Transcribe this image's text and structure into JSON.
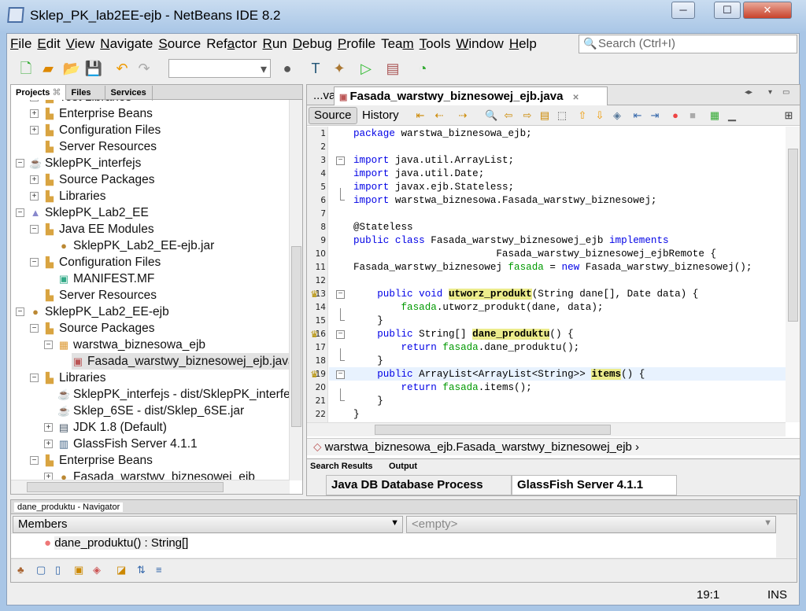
{
  "window": {
    "title": "Sklep_PK_lab2EE-ejb - NetBeans IDE 8.2",
    "minimize": "─",
    "maximize": "☐",
    "close": "✕"
  },
  "menu": [
    {
      "u": "F",
      "rest": "ile"
    },
    {
      "u": "E",
      "rest": "dit"
    },
    {
      "u": "V",
      "rest": "iew"
    },
    {
      "u": "N",
      "rest": "avigate"
    },
    {
      "u": "S",
      "rest": "ource"
    },
    {
      "pre": "Ref",
      "u": "a",
      "rest": "ctor"
    },
    {
      "u": "R",
      "rest": "un"
    },
    {
      "u": "D",
      "rest": "ebug"
    },
    {
      "u": "P",
      "rest": "rofile"
    },
    {
      "pre": "Tea",
      "u": "m",
      "rest": ""
    },
    {
      "u": "T",
      "rest": "ools"
    },
    {
      "u": "W",
      "rest": "indow"
    },
    {
      "u": "H",
      "rest": "elp"
    }
  ],
  "search": {
    "placeholder": "Search (Ctrl+I)"
  },
  "projects": {
    "tabs": [
      "Projects",
      "Files",
      "Services"
    ],
    "close_glyph": "⌘",
    "items": [
      {
        "label": "Test Libraries",
        "level": 1,
        "exp": "+",
        "icon": "library-folder-icon"
      },
      {
        "label": "Enterprise Beans",
        "level": 1,
        "exp": "+",
        "icon": "beans-folder-icon"
      },
      {
        "label": "Configuration Files",
        "level": 1,
        "exp": "+",
        "icon": "config-folder-icon"
      },
      {
        "label": "Server Resources",
        "level": 1,
        "exp": "",
        "icon": "server-folder-icon"
      },
      {
        "label": "SklepPK_interfejs",
        "level": 0,
        "exp": "−",
        "icon": "java-project-icon"
      },
      {
        "label": "Source Packages",
        "level": 1,
        "exp": "+",
        "icon": "source-folder-icon"
      },
      {
        "label": "Libraries",
        "level": 1,
        "exp": "+",
        "icon": "library-folder-icon"
      },
      {
        "label": "SklepPK_Lab2_EE",
        "level": 0,
        "exp": "−",
        "icon": "ee-project-icon"
      },
      {
        "label": "Java EE Modules",
        "level": 1,
        "exp": "−",
        "icon": "modules-folder-icon"
      },
      {
        "label": "SklepPK_Lab2_EE-ejb.jar",
        "level": 2,
        "exp": "",
        "icon": "bean-jar-icon"
      },
      {
        "label": "Configuration Files",
        "level": 1,
        "exp": "−",
        "icon": "config-folder-icon"
      },
      {
        "label": "MANIFEST.MF",
        "level": 2,
        "exp": "",
        "icon": "manifest-file-icon"
      },
      {
        "label": "Server Resources",
        "level": 1,
        "exp": "",
        "icon": "server-folder-icon"
      },
      {
        "label": "SklepPK_Lab2_EE-ejb",
        "level": 0,
        "exp": "−",
        "icon": "ejb-project-icon"
      },
      {
        "label": "Source Packages",
        "level": 1,
        "exp": "−",
        "icon": "source-folder-icon"
      },
      {
        "label": "warstwa_biznesowa_ejb",
        "level": 2,
        "exp": "−",
        "icon": "package-icon"
      },
      {
        "label": "Fasada_warstwy_biznesowej_ejb.java",
        "level": 3,
        "exp": "",
        "icon": "java-file-icon",
        "selected": true
      },
      {
        "label": "Libraries",
        "level": 1,
        "exp": "−",
        "icon": "library-folder-icon"
      },
      {
        "label": "SklepPK_interfejs - dist/SklepPK_interfejs.jar",
        "level": 2,
        "exp": "",
        "icon": "java-project-icon"
      },
      {
        "label": "Sklep_6SE - dist/Sklep_6SE.jar",
        "level": 2,
        "exp": "",
        "icon": "java-project-icon"
      },
      {
        "label": "JDK 1.8 (Default)",
        "level": 2,
        "exp": "+",
        "icon": "jdk-icon"
      },
      {
        "label": "GlassFish Server 4.1.1",
        "level": 2,
        "exp": "+",
        "icon": "server-icon"
      },
      {
        "label": "Enterprise Beans",
        "level": 1,
        "exp": "−",
        "icon": "beans-folder-icon"
      },
      {
        "label": "Fasada_warstwy_biznesowej_ejb",
        "level": 2,
        "exp": "+",
        "icon": "bean-icon"
      }
    ]
  },
  "editor": {
    "prev_tab": "...va",
    "active_tab": "Fasada_warstwy_biznesowej_ejb.java",
    "source_label": "Source",
    "history_label": "History",
    "current_line": 19,
    "lines": [
      [
        {
          "k": "kw",
          "t": "package"
        },
        {
          "t": " warstwa_biznesowa_ejb;"
        }
      ],
      [],
      [
        {
          "k": "kw",
          "t": "import"
        },
        {
          "t": " java.util.ArrayList;"
        }
      ],
      [
        {
          "k": "kw",
          "t": "import"
        },
        {
          "t": " java.util.Date;"
        }
      ],
      [
        {
          "k": "kw",
          "t": "import"
        },
        {
          "t": " javax.ejb.Stateless;"
        }
      ],
      [
        {
          "k": "kw",
          "t": "import"
        },
        {
          "t": " warstwa_biznesowa.Fasada_warstwy_biznesowej;"
        }
      ],
      [],
      [
        {
          "t": "@Stateless"
        }
      ],
      [
        {
          "k": "kw",
          "t": "public class"
        },
        {
          "t": " Fasada_warstwy_biznesowej_ejb "
        },
        {
          "k": "kw",
          "t": "implements"
        }
      ],
      [
        {
          "t": "                        Fasada_warstwy_biznesowej_ejbRemote {"
        }
      ],
      [
        {
          "t": "Fasada_warstwy_biznesowej "
        },
        {
          "k": "fld",
          "t": "fasada"
        },
        {
          "t": " = "
        },
        {
          "k": "kw",
          "t": "new"
        },
        {
          "t": " Fasada_warstwy_biznesowej();"
        }
      ],
      [],
      [
        {
          "t": "    "
        },
        {
          "k": "kw",
          "t": "public void"
        },
        {
          "t": " "
        },
        {
          "k": "hl",
          "t": "utworz_produkt"
        },
        {
          "t": "(String dane[], Date data) {"
        }
      ],
      [
        {
          "t": "        "
        },
        {
          "k": "fld",
          "t": "fasada"
        },
        {
          "t": ".utworz_produkt(dane, data);"
        }
      ],
      [
        {
          "t": "    }"
        }
      ],
      [
        {
          "t": "    "
        },
        {
          "k": "kw",
          "t": "public"
        },
        {
          "t": " String[] "
        },
        {
          "k": "hl",
          "t": "dane_produktu"
        },
        {
          "t": "() {"
        }
      ],
      [
        {
          "t": "        "
        },
        {
          "k": "kw",
          "t": "return"
        },
        {
          "t": " "
        },
        {
          "k": "fld",
          "t": "fasada"
        },
        {
          "t": ".dane_produktu();"
        }
      ],
      [
        {
          "t": "    }"
        }
      ],
      [
        {
          "t": "    "
        },
        {
          "k": "kw",
          "t": "public"
        },
        {
          "t": " ArrayList<ArrayList<String>> "
        },
        {
          "k": "hl",
          "t": "items"
        },
        {
          "t": "() {"
        }
      ],
      [
        {
          "t": "        "
        },
        {
          "k": "kw",
          "t": "return"
        },
        {
          "t": " "
        },
        {
          "k": "fld",
          "t": "fasada"
        },
        {
          "t": ".items();"
        }
      ],
      [
        {
          "t": "    }"
        }
      ],
      [
        {
          "t": "}"
        }
      ]
    ],
    "folds": {
      "3": "−",
      "6": "└",
      "13": "−",
      "15": "└",
      "16": "−",
      "18": "└",
      "19": "−",
      "21": "└"
    },
    "override_marks": [
      13,
      16,
      19
    ],
    "breadcrumb": "warstwa_biznesowa_ejb.Fasada_warstwy_biznesowej_ejb"
  },
  "output": {
    "small_tabs": [
      "Search Results",
      "Output"
    ],
    "tabs": [
      "Java DB Database Process",
      "GlassFish Server 4.1.1"
    ]
  },
  "navigator": {
    "title": "dane_produktu - Navigator",
    "filter": "Members",
    "second": "<empty>",
    "item": "dane_produktu() : String[]"
  },
  "status": {
    "position": "19:1",
    "mode": "INS"
  }
}
